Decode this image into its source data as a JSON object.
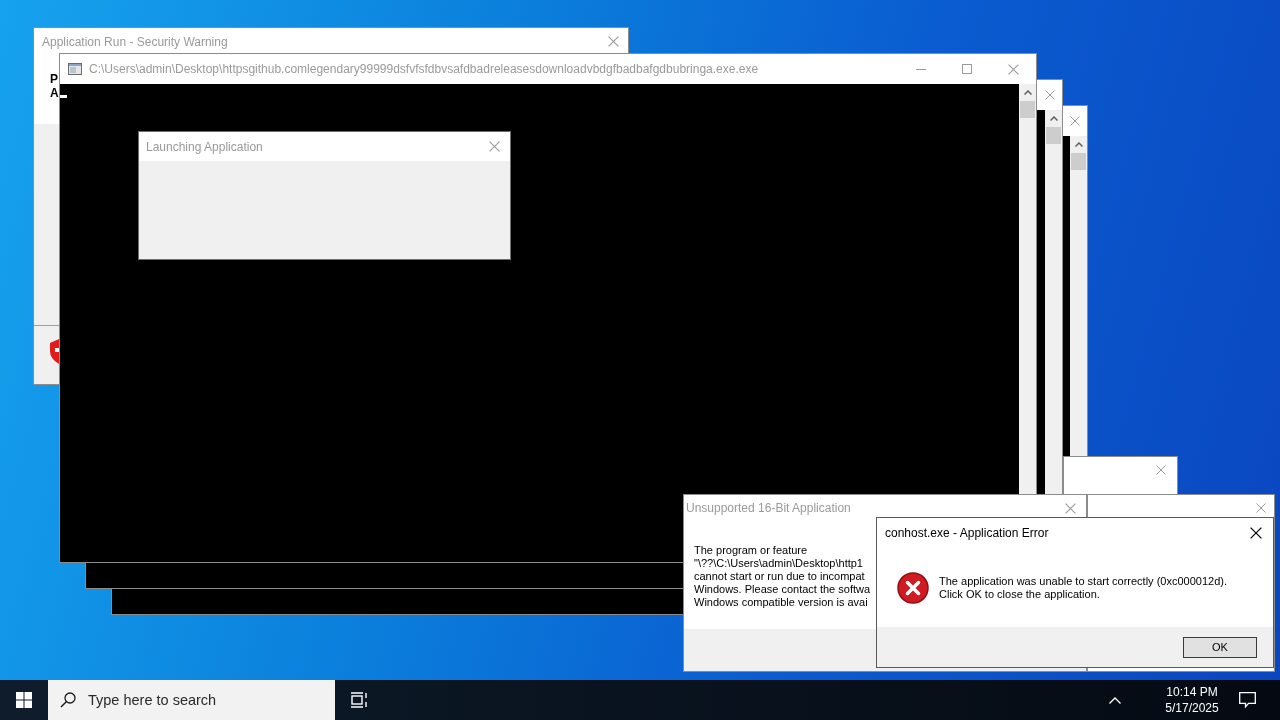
{
  "desktop": {
    "security_window": {
      "title": "Application Run - Security Warning",
      "active": false,
      "text_lines": [
        "P",
        "A"
      ]
    },
    "console_window": {
      "title": "C:\\Users\\admin\\Desktop\\httpsgithub.comlegendary99999dsfvfsfdbvsafdbadreleasesdownloadvbdgfbadbafgdbubringa.exe.exe",
      "active": false
    },
    "launching_dialog": {
      "title": "Launching Application",
      "active": false
    },
    "unsupported_dialog": {
      "title": "Unsupported 16-Bit Application",
      "active": false,
      "message_lines": [
        "The program or feature",
        "\"\\??\\C:\\Users\\admin\\Desktop\\http1",
        "cannot start or run due to incompat",
        "Windows. Please contact the softwa",
        "Windows compatible version is avai"
      ]
    },
    "error_dialog": {
      "title": "conhost.exe - Application Error",
      "active": true,
      "message_lines": [
        "The application was unable to start correctly (0xc000012d).",
        "Click OK to close the application."
      ],
      "button": "OK"
    }
  },
  "taskbar": {
    "search": {
      "placeholder": "Type here to search"
    },
    "clock": {
      "time": "10:14 PM",
      "date": "5/17/2025"
    }
  }
}
